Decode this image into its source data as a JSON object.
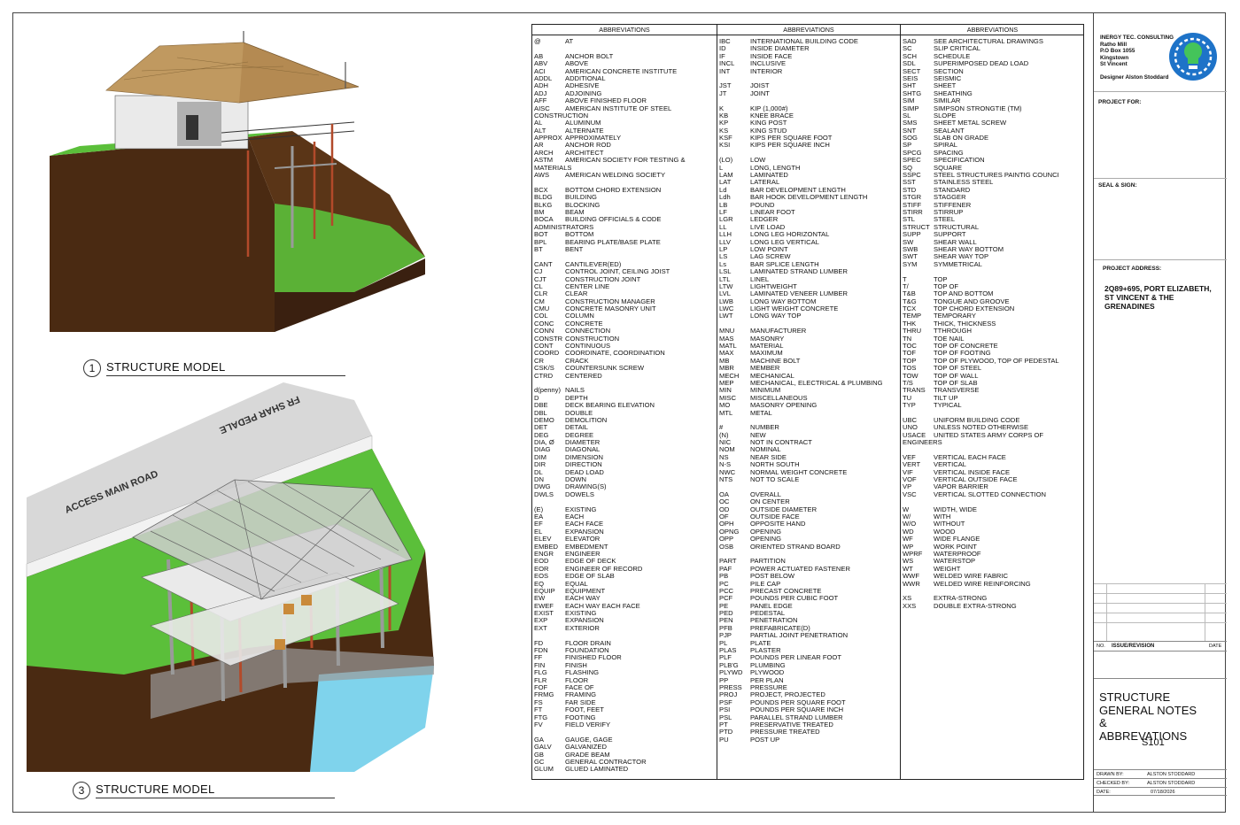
{
  "views": [
    {
      "number": "1",
      "title": "STRUCTURE MODEL"
    },
    {
      "number": "3",
      "title": "STRUCTURE MODEL"
    }
  ],
  "road_labels": {
    "road1": "ACCESS MAIN ROAD",
    "road2": "FR SHAR PEDALE"
  },
  "abbreviations": {
    "header": "ABBREVIATIONS",
    "columns": [
      [
        [
          "@",
          "AT"
        ],
        [
          "",
          ""
        ],
        [
          "AB",
          "ANCHOR BOLT"
        ],
        [
          "ABV",
          "ABOVE"
        ],
        [
          "ACI",
          "AMERICAN CONCRETE INSTITUTE"
        ],
        [
          "ADDL",
          "ADDITIONAL"
        ],
        [
          "ADH",
          "ADHESIVE"
        ],
        [
          "ADJ",
          "ADJOINING"
        ],
        [
          "AFF",
          "ABOVE FINISHED FLOOR"
        ],
        [
          "AISC",
          "AMERICAN INSTITUTE OF STEEL"
        ],
        [
          "CONSTRUCTION",
          ""
        ],
        [
          "AL",
          "ALUMINUM"
        ],
        [
          "ALT",
          "ALTERNATE"
        ],
        [
          "APPROX",
          "APPROXIMATELY"
        ],
        [
          "AR",
          "ANCHOR ROD"
        ],
        [
          "ARCH",
          "ARCHITECT"
        ],
        [
          "ASTM",
          "AMERICAN SOCIETY FOR TESTING &"
        ],
        [
          "MATERIALS",
          ""
        ],
        [
          "AWS",
          "AMERICAN WELDING SOCIETY"
        ],
        [
          "",
          ""
        ],
        [
          "BCX",
          "BOTTOM CHORD EXTENSION"
        ],
        [
          "BLDG",
          "BUILDING"
        ],
        [
          "BLKG",
          "BLOCKING"
        ],
        [
          "BM",
          "BEAM"
        ],
        [
          "BOCA",
          "BUILDING OFFICIALS & CODE"
        ],
        [
          "ADMINISTRATORS",
          ""
        ],
        [
          "BOT",
          "BOTTOM"
        ],
        [
          "BPL",
          "BEARING PLATE/BASE PLATE"
        ],
        [
          "BT",
          "BENT"
        ],
        [
          "",
          ""
        ],
        [
          "CANT",
          "CANTILEVER(ED)"
        ],
        [
          "CJ",
          "CONTROL JOINT, CEILING JOIST"
        ],
        [
          "CJT",
          "CONSTRUCTION JOINT"
        ],
        [
          "CL",
          "CENTER LINE"
        ],
        [
          "CLR",
          "CLEAR"
        ],
        [
          "CM",
          "CONSTRUCTION MANAGER"
        ],
        [
          "CMU",
          "CONCRETE MASONRY UNIT"
        ],
        [
          "COL",
          "COLUMN"
        ],
        [
          "CONC",
          "CONCRETE"
        ],
        [
          "CONN",
          "CONNECTION"
        ],
        [
          "CONSTR",
          "CONSTRUCTION"
        ],
        [
          "CONT",
          "CONTINUOUS"
        ],
        [
          "COORD",
          "COORDINATE, COORDINATION"
        ],
        [
          "CR",
          "CRACK"
        ],
        [
          "CSK/S",
          "COUNTERSUNK SCREW"
        ],
        [
          "CTRD",
          "CENTERED"
        ],
        [
          "",
          ""
        ],
        [
          "d(penny)",
          "NAILS"
        ],
        [
          "D",
          "DEPTH"
        ],
        [
          "DBE",
          "DECK BEARING ELEVATION"
        ],
        [
          "DBL",
          "DOUBLE"
        ],
        [
          "DEMO",
          "DEMOLITION"
        ],
        [
          "DET",
          "DETAIL"
        ],
        [
          "DEG",
          "DEGREE"
        ],
        [
          "DIA, Ø",
          "DIAMETER"
        ],
        [
          "DIAG",
          "DIAGONAL"
        ],
        [
          "DIM",
          "DIMENSION"
        ],
        [
          "DIR",
          "DIRECTION"
        ],
        [
          "DL",
          "DEAD LOAD"
        ],
        [
          "DN",
          "DOWN"
        ],
        [
          "DWG",
          "DRAWING(S)"
        ],
        [
          "DWLS",
          "DOWELS"
        ],
        [
          "",
          ""
        ],
        [
          "(E)",
          "EXISTING"
        ],
        [
          "EA",
          "EACH"
        ],
        [
          "EF",
          "EACH FACE"
        ],
        [
          "EL",
          "EXPANSION"
        ],
        [
          "ELEV",
          "ELEVATOR"
        ],
        [
          "EMBED",
          "EMBEDMENT"
        ],
        [
          "ENGR",
          "ENGINEER"
        ],
        [
          "EOD",
          "EDGE OF DECK"
        ],
        [
          "EOR",
          "ENGINEER OF RECORD"
        ],
        [
          "EOS",
          "EDGE OF SLAB"
        ],
        [
          "EQ",
          "EQUAL"
        ],
        [
          "EQUIP",
          "EQUIPMENT"
        ],
        [
          "EW",
          "EACH WAY"
        ],
        [
          "EWEF",
          "EACH WAY EACH FACE"
        ],
        [
          "EXIST",
          "EXISTING"
        ],
        [
          "EXP",
          "EXPANSION"
        ],
        [
          "EXT",
          "EXTERIOR"
        ],
        [
          "",
          ""
        ],
        [
          "FD",
          "FLOOR DRAIN"
        ],
        [
          "FDN",
          "FOUNDATION"
        ],
        [
          "FF",
          "FINISHED FLOOR"
        ],
        [
          "FIN",
          "FINISH"
        ],
        [
          "FLG",
          "FLASHING"
        ],
        [
          "FLR",
          "FLOOR"
        ],
        [
          "FOF",
          "FACE OF"
        ],
        [
          "FRMG",
          "FRAMING"
        ],
        [
          "FS",
          "FAR SIDE"
        ],
        [
          "FT",
          "FOOT, FEET"
        ],
        [
          "FTG",
          "FOOTING"
        ],
        [
          "FV",
          "FIELD VERIFY"
        ],
        [
          "",
          ""
        ],
        [
          "GA",
          "GAUGE, GAGE"
        ],
        [
          "GALV",
          "GALVANIZED"
        ],
        [
          "GB",
          "GRADE BEAM"
        ],
        [
          "GC",
          "GENERAL CONTRACTOR"
        ],
        [
          "GLUM",
          "GLUED LAMINATED"
        ]
      ],
      [
        [
          "IBC",
          "INTERNATIONAL BUILDING CODE"
        ],
        [
          "ID",
          "INSIDE DIAMETER"
        ],
        [
          "IF",
          "INSIDE FACE"
        ],
        [
          "INCL",
          "INCLUSIVE"
        ],
        [
          "INT",
          "INTERIOR"
        ],
        [
          "",
          ""
        ],
        [
          "JST",
          "JOIST"
        ],
        [
          "JT",
          "JOINT"
        ],
        [
          "",
          ""
        ],
        [
          "K",
          "KIP (1,000#)"
        ],
        [
          "KB",
          "KNEE BRACE"
        ],
        [
          "KP",
          "KING POST"
        ],
        [
          "KS",
          "KING STUD"
        ],
        [
          "KSF",
          "KIPS PER SQUARE FOOT"
        ],
        [
          "KSI",
          "KIPS PER SQUARE INCH"
        ],
        [
          "",
          ""
        ],
        [
          "(LO)",
          "LOW"
        ],
        [
          "L",
          "LONG, LENGTH"
        ],
        [
          "LAM",
          "LAMINATED"
        ],
        [
          "LAT",
          "LATERAL"
        ],
        [
          "Ld",
          "BAR DEVELOPMENT LENGTH"
        ],
        [
          "Ldh",
          "BAR HOOK DEVELOPMENT LENGTH"
        ],
        [
          "LB",
          "POUND"
        ],
        [
          "LF",
          "LINEAR FOOT"
        ],
        [
          "LGR",
          "LEDGER"
        ],
        [
          "LL",
          "LIVE LOAD"
        ],
        [
          "LLH",
          "LONG LEG HORIZONTAL"
        ],
        [
          "LLV",
          "LONG LEG VERTICAL"
        ],
        [
          "LP",
          "LOW POINT"
        ],
        [
          "LS",
          "LAG SCREW"
        ],
        [
          "Ls",
          "BAR SPLICE LENGTH"
        ],
        [
          "LSL",
          "LAMINATED STRAND LUMBER"
        ],
        [
          "LTL",
          "LINEL"
        ],
        [
          "LTW",
          "LIGHTWEIGHT"
        ],
        [
          "LVL",
          "LAMINATED VENEER LUMBER"
        ],
        [
          "LWB",
          "LONG WAY BOTTOM"
        ],
        [
          "LWC",
          "LIGHT WEIGHT CONCRETE"
        ],
        [
          "LWT",
          "LONG WAY TOP"
        ],
        [
          "",
          ""
        ],
        [
          "MNU",
          "MANUFACTURER"
        ],
        [
          "MAS",
          "MASONRY"
        ],
        [
          "MATL",
          "MATERIAL"
        ],
        [
          "MAX",
          "MAXIMUM"
        ],
        [
          "MB",
          "MACHINE BOLT"
        ],
        [
          "MBR",
          "MEMBER"
        ],
        [
          "MECH",
          "MECHANICAL"
        ],
        [
          "MEP",
          "MECHANICAL, ELECTRICAL & PLUMBING"
        ],
        [
          "MIN",
          "MINIMUM"
        ],
        [
          "MISC",
          "MISCELLANEOUS"
        ],
        [
          "MO",
          "MASONRY OPENING"
        ],
        [
          "MTL",
          "METAL"
        ],
        [
          "",
          ""
        ],
        [
          "#",
          "NUMBER"
        ],
        [
          "(N)",
          "NEW"
        ],
        [
          "NIC",
          "NOT IN CONTRACT"
        ],
        [
          "NOM",
          "NOMINAL"
        ],
        [
          "NS",
          "NEAR SIDE"
        ],
        [
          "N-S",
          "NORTH SOUTH"
        ],
        [
          "NWC",
          "NORMAL WEIGHT CONCRETE"
        ],
        [
          "NTS",
          "NOT TO SCALE"
        ],
        [
          "",
          ""
        ],
        [
          "OA",
          "OVERALL"
        ],
        [
          "OC",
          "ON CENTER"
        ],
        [
          "OD",
          "OUTSIDE DIAMETER"
        ],
        [
          "OF",
          "OUTSIDE FACE"
        ],
        [
          "OPH",
          "OPPOSITE HAND"
        ],
        [
          "OPNG",
          "OPENING"
        ],
        [
          "OPP",
          "OPENING"
        ],
        [
          "OSB",
          "ORIENTED STRAND BOARD"
        ],
        [
          "",
          ""
        ],
        [
          "PART",
          "PARTITION"
        ],
        [
          "PAF",
          "POWER ACTUATED FASTENER"
        ],
        [
          "PB",
          "POST BELOW"
        ],
        [
          "PC",
          "PILE CAP"
        ],
        [
          "PCC",
          "PRECAST CONCRETE"
        ],
        [
          "PCF",
          "POUNDS PER CUBIC FOOT"
        ],
        [
          "PE",
          "PANEL EDGE"
        ],
        [
          "PED",
          "PEDESTAL"
        ],
        [
          "PEN",
          "PENETRATION"
        ],
        [
          "PFB",
          "PREFABRICATE(D)"
        ],
        [
          "PJP",
          "PARTIAL JOINT PENETRATION"
        ],
        [
          "PL",
          "PLATE"
        ],
        [
          "PLAS",
          "PLASTER"
        ],
        [
          "PLF",
          "POUNDS PER LINEAR FOOT"
        ],
        [
          "PLB'G",
          "PLUMBING"
        ],
        [
          "PLYWD",
          "PLYWOOD"
        ],
        [
          "PP",
          "PER PLAN"
        ],
        [
          "PRESS",
          "PRESSURE"
        ],
        [
          "PROJ",
          "PROJECT, PROJECTED"
        ],
        [
          "PSF",
          "POUNDS PER SQUARE FOOT"
        ],
        [
          "PSI",
          "POUNDS PER SQUARE INCH"
        ],
        [
          "PSL",
          "PARALLEL STRAND LUMBER"
        ],
        [
          "PT",
          "PRESERVATIVE TREATED"
        ],
        [
          "PTD",
          "PRESSURE TREATED"
        ],
        [
          "PU",
          "POST UP"
        ]
      ],
      [
        [
          "SAD",
          "SEE ARCHITECTURAL DRAWINGS"
        ],
        [
          "SC",
          "SLIP CRITICAL"
        ],
        [
          "SCH",
          "SCHEDULE"
        ],
        [
          "SDL",
          "SUPERIMPOSED DEAD LOAD"
        ],
        [
          "SECT",
          "SECTION"
        ],
        [
          "SEIS",
          "SEISMIC"
        ],
        [
          "SHT",
          "SHEET"
        ],
        [
          "SHTG",
          "SHEATHING"
        ],
        [
          "SIM",
          "SIMILAR"
        ],
        [
          "SIMP",
          "SIMPSON STRONGTIE (TM)"
        ],
        [
          "SL",
          "SLOPE"
        ],
        [
          "SMS",
          "SHEET METAL SCREW"
        ],
        [
          "SNT",
          "SEALANT"
        ],
        [
          "SOG",
          "SLAB ON GRADE"
        ],
        [
          "SP",
          "SPIRAL"
        ],
        [
          "SPCG",
          "SPACING"
        ],
        [
          "SPEC",
          "SPECIFICATION"
        ],
        [
          "SQ",
          "SQUARE"
        ],
        [
          "SSPC",
          "STEEL STRUCTURES PAINTIG COUNCI"
        ],
        [
          "SST",
          "STAINLESS STEEL"
        ],
        [
          "STD",
          "STANDARD"
        ],
        [
          "STGR",
          "STAGGER"
        ],
        [
          "STIFF",
          "STIFFENER"
        ],
        [
          "STIRR",
          "STIRRUP"
        ],
        [
          "STL",
          "STEEL"
        ],
        [
          "STRUCT",
          "STRUCTURAL"
        ],
        [
          "SUPP",
          "SUPPORT"
        ],
        [
          "SW",
          "SHEAR WALL"
        ],
        [
          "SWB",
          "SHEAR WAY BOTTOM"
        ],
        [
          "SWT",
          "SHEAR WAY TOP"
        ],
        [
          "SYM",
          "SYMMETRICAL"
        ],
        [
          "",
          ""
        ],
        [
          "T",
          "TOP"
        ],
        [
          "T/",
          "TOP OF"
        ],
        [
          "T&B",
          "TOP AND BOTTOM"
        ],
        [
          "T&G",
          "TONGUE AND GROOVE"
        ],
        [
          "TCX",
          "TOP CHORD EXTENSION"
        ],
        [
          "TEMP",
          "TEMPORARY"
        ],
        [
          "THK",
          "THICK, THICKNESS"
        ],
        [
          "THRU",
          "TTHROUGH"
        ],
        [
          "TN",
          "TOE NAIL"
        ],
        [
          "TOC",
          "TOP OF CONCRETE"
        ],
        [
          "TOF",
          "TOP OF FOOTING"
        ],
        [
          "TOP",
          "TOP OF PLYWOOD, TOP OF PEDESTAL"
        ],
        [
          "TOS",
          "TOP OF STEEL"
        ],
        [
          "TOW",
          "TOP OF WALL"
        ],
        [
          "T/S",
          "TOP OF SLAB"
        ],
        [
          "TRANS",
          "TRANSVERSE"
        ],
        [
          "TU",
          "TILT UP"
        ],
        [
          "TYP",
          "TYPICAL"
        ],
        [
          "",
          ""
        ],
        [
          "UBC",
          "UNIFORM BUILDING CODE"
        ],
        [
          "UNO",
          "UNLESS NOTED OTHERWISE"
        ],
        [
          "USACE",
          "UNITED STATES ARMY CORPS OF"
        ],
        [
          "ENGINEERS",
          ""
        ],
        [
          "",
          ""
        ],
        [
          "VEF",
          "VERTICAL EACH FACE"
        ],
        [
          "VERT",
          "VERTICAL"
        ],
        [
          "VIF",
          "VERTICAL INSIDE FACE"
        ],
        [
          "VOF",
          "VERTICAL OUTSIDE FACE"
        ],
        [
          "VP",
          "VAPOR BARRIER"
        ],
        [
          "VSC",
          "VERTICAL SLOTTED CONNECTION"
        ],
        [
          "",
          ""
        ],
        [
          "W",
          "WIDTH, WIDE"
        ],
        [
          "W/",
          "WITH"
        ],
        [
          "W/O",
          "WITHOUT"
        ],
        [
          "WD",
          "WOOD"
        ],
        [
          "WF",
          "WIDE FLANGE"
        ],
        [
          "WP",
          "WORK POINT"
        ],
        [
          "WPRF",
          "WATERPROOF"
        ],
        [
          "WS",
          "WATERSTOP"
        ],
        [
          "WT",
          "WEIGHT"
        ],
        [
          "WWF",
          "WELDED WIRE FABRIC"
        ],
        [
          "WWR",
          "WELDED WIRE REINFORCING"
        ],
        [
          "",
          ""
        ],
        [
          "XS",
          "EXTRA-STRONG"
        ],
        [
          "XXS",
          "DOUBLE EXTRA-STRONG"
        ]
      ]
    ]
  },
  "title_block": {
    "company": [
      "INERGY TEC. CONSULTING",
      "Ratho Mill",
      "P.O Box 1055",
      "Kingstown",
      "St Vincent"
    ],
    "designer": "Designer Alston Stoddard",
    "project_for_label": "PROJECT FOR:",
    "seal_label": "SEAL & SIGN:",
    "address_label": "PROJECT ADDRESS:",
    "address": [
      "2Q89+695, PORT ELIZABETH,",
      "ST VINCENT & THE",
      "GRENADINES"
    ],
    "issue_no_label": "NO.",
    "issue_label": "ISSUE/REVISION",
    "date_label": "DATE",
    "sheet_title": [
      "STRUCTURE",
      "GENERAL NOTES",
      "&",
      "ABBREVATIONS"
    ],
    "sheet_number": "S101",
    "drawn_by_label": "DRAWN BY:",
    "drawn_by": "ALSTON STODDARD",
    "checked_by_label": "CHECKED BY:",
    "checked_by": "ALSTON STODDARD",
    "date_field_label": "DATE:",
    "date": "07/18/2026"
  },
  "colors": {
    "soil": "#4a2a12",
    "grass": "#5bbf3a",
    "water": "#7fd3ec",
    "roof": "#b48a52",
    "logo": "#1e73c8",
    "logo_accent": "#44c45a"
  }
}
